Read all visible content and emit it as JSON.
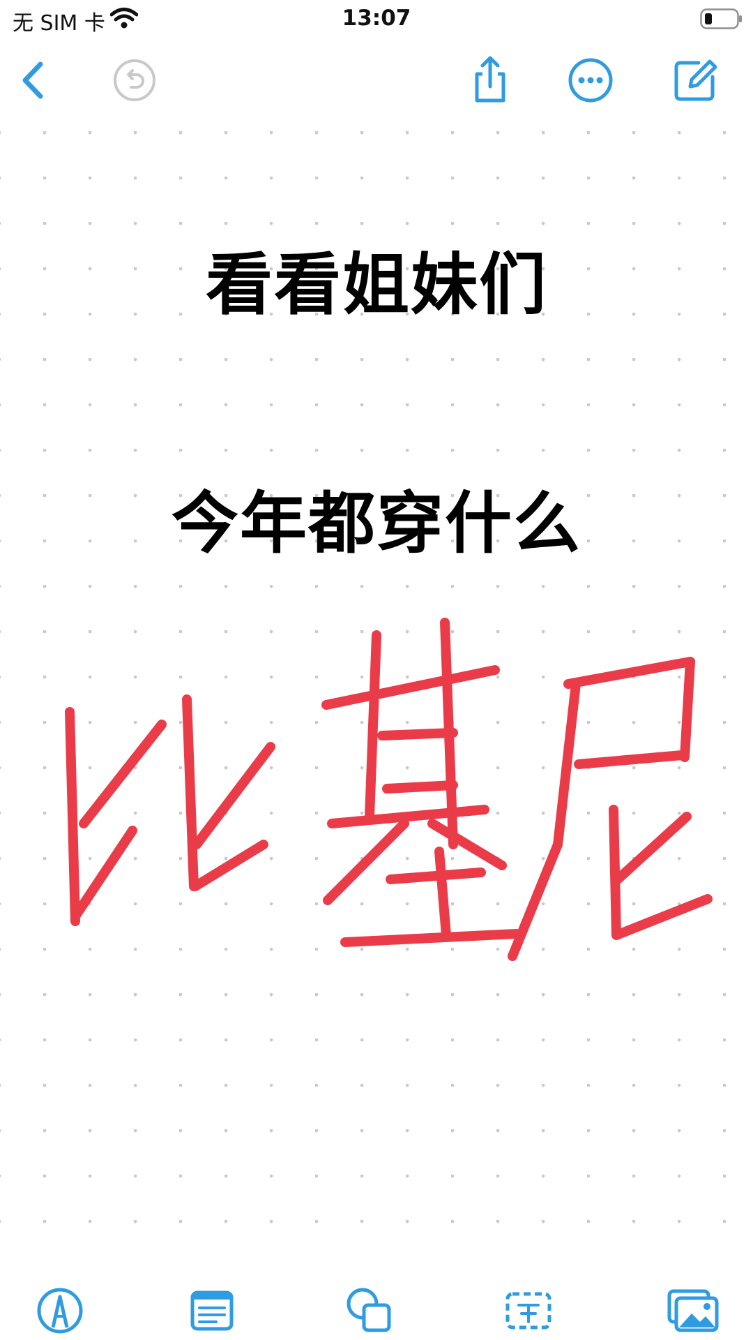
{
  "status": {
    "carrier": "无 SIM 卡",
    "time": "13:07"
  },
  "toolbar": {
    "back_icon": "chevron-left-icon",
    "undo_icon": "undo-icon",
    "share_icon": "share-icon",
    "more_icon": "ellipsis-circle-icon",
    "compose_icon": "compose-icon"
  },
  "note": {
    "line1": "看看姐妹们",
    "line2": "今年都穿什么",
    "handwriting": "比基尼",
    "handwriting_color": "#E9323F",
    "background": "dot-grid"
  },
  "bottom_tools": {
    "items": [
      {
        "icon": "markup-pen-icon"
      },
      {
        "icon": "checklist-icon"
      },
      {
        "icon": "shapes-icon"
      },
      {
        "icon": "text-box-icon"
      },
      {
        "icon": "image-icon"
      }
    ]
  },
  "colors": {
    "accent": "#2F9BE0",
    "disabled": "#C7C7CC",
    "text": "#000000"
  }
}
